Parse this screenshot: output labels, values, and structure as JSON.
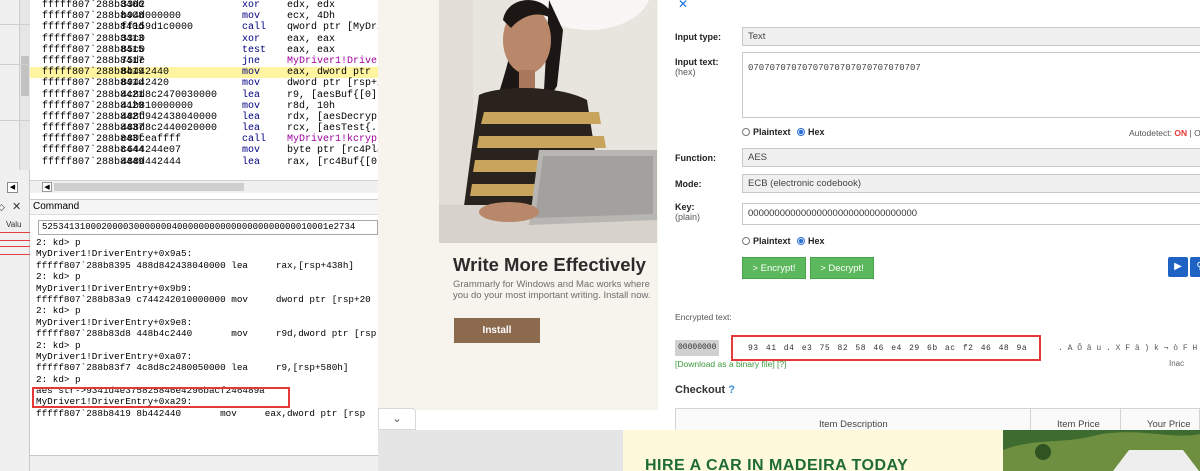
{
  "debugger": {
    "left_panel": {
      "value_label": "Valu",
      "close_glyph": "✕"
    },
    "disasm": [
      {
        "addr": "fffff807`288b8406",
        "bytes": "33d2",
        "mnemonic": "xor",
        "operand": "edx, edx"
      },
      {
        "addr": "fffff807`288b8408",
        "bytes": "b94d000000",
        "mnemonic": "mov",
        "operand": "ecx, 4Dh"
      },
      {
        "addr": "fffff807`288b840d",
        "bytes": "ff159d1c0000",
        "mnemonic": "call",
        "operand": "qword ptr [MyDriv"
      },
      {
        "addr": "fffff807`288b8413",
        "bytes": "33c0",
        "mnemonic": "xor",
        "operand": "eax, eax"
      },
      {
        "addr": "fffff807`288b8415",
        "bytes": "85c0",
        "mnemonic": "test",
        "operand": "eax, eax"
      },
      {
        "addr": "fffff807`288b8417",
        "bytes": "75de",
        "mnemonic": "jne",
        "operand": "MyDriver1!Driver"
      },
      {
        "addr": "fffff807`288b8419",
        "bytes": "8b442440",
        "mnemonic": "mov",
        "operand": "eax, dword ptr ["
      },
      {
        "addr": "fffff807`288b841d",
        "bytes": "89442420",
        "mnemonic": "mov",
        "operand": "dword ptr [rsp+2"
      },
      {
        "addr": "fffff807`288b8421",
        "bytes": "4c8d8c2470030000",
        "mnemonic": "lea",
        "operand": "r9, [aesBuf{[0]"
      },
      {
        "addr": "fffff807`288b8429",
        "bytes": "41b810000000",
        "mnemonic": "mov",
        "operand": "r8d, 10h"
      },
      {
        "addr": "fffff807`288b842f",
        "bytes": "488d942438040000",
        "mnemonic": "lea",
        "operand": "rdx, [aesDecrypt"
      },
      {
        "addr": "fffff807`288b8437",
        "bytes": "488d8c2440020000",
        "mnemonic": "lea",
        "operand": "rcx, [aesTest{."
      },
      {
        "addr": "fffff807`288b843f",
        "bytes": "e80ceaffff",
        "mnemonic": "call",
        "operand": "MyDriver1!kcrypt"
      },
      {
        "addr": "fffff807`288b8444",
        "bytes": "c644244e07",
        "mnemonic": "mov",
        "operand": "byte ptr [rc4Pla"
      },
      {
        "addr": "fffff807`288b8449",
        "bytes": "488d442444",
        "mnemonic": "lea",
        "operand": "rax, [rc4Buf{[0]"
      }
    ],
    "highlight_index": 6,
    "command": {
      "title": "Command",
      "input": "52534131000200003000000040000000000000000000000010001e2734",
      "output": [
        "2: kd> p",
        "MyDriver1!DriverEntry+0x9a5:",
        "fffff807`288b8395 488d842438040000 lea     rax,[rsp+438h]",
        "2: kd> p",
        "MyDriver1!DriverEntry+0x9b9:",
        "fffff807`288b83a9 c744242010000000 mov     dword ptr [rsp+20",
        "2: kd> p",
        "MyDriver1!DriverEntry+0x9e8:",
        "fffff807`288b83d8 448b4c2440       mov     r9d,dword ptr [rsp",
        "2: kd> p",
        "MyDriver1!DriverEntry+0xa07:",
        "fffff807`288b83f7 4c8d8c2480050000 lea     r9,[rsp+580h]",
        "2: kd> p",
        "aes str->9341d4e375825846e4296bacf246489a",
        "MyDriver1!DriverEntry+0xa29:",
        "fffff807`288b8419 8b442440       mov     eax,dword ptr [rsp"
      ]
    }
  },
  "ad": {
    "title": "Write More Effectively",
    "subtitle": "Grammarly for Windows and Mac works where you do your most important writing. Install now.",
    "install_label": "Install",
    "close_glyph": "✕"
  },
  "form": {
    "input_type_label": "Input type:",
    "input_type_value": "Text",
    "input_text_label": "Input text:",
    "input_text_sub": "(hex)",
    "input_text_value": "07070707070707070707070707070707",
    "plaintext_label": "Plaintext",
    "hex_label": "Hex",
    "autodetect_label": "Autodetect:",
    "autodetect_on": "ON",
    "autodetect_sep": "|",
    "autodetect_off": "O",
    "function_label": "Function:",
    "function_value": "AES",
    "mode_label": "Mode:",
    "mode_value": "ECB (electronic codebook)",
    "key_label": "Key:",
    "key_sub": "(plain)",
    "key_value": "00000000000000000000000000000000",
    "encrypt_label": "> Encrypt!",
    "decrypt_label": "> Decrypt!",
    "encrypted_text_label": "Encrypted text:",
    "encrypted_prefix": "00000000",
    "encrypted_hex": "93 41 d4 e3 75 82 58 46 e4 29 6b ac f2 46 48 9a",
    "encrypted_ascii": ". A Ô ä u . X F ä ) k ¬ ò F H",
    "download_link": "[Download as a binary file] [?]",
    "inadv_label": "Inac",
    "checkout_label": "Checkout",
    "checkout_help": "?",
    "columns": [
      "Item Description",
      "Item Price",
      "Your Price"
    ]
  },
  "banner": {
    "text": "HIRE A CAR IN MADEIRA TODAY"
  },
  "chevron": "⌄"
}
